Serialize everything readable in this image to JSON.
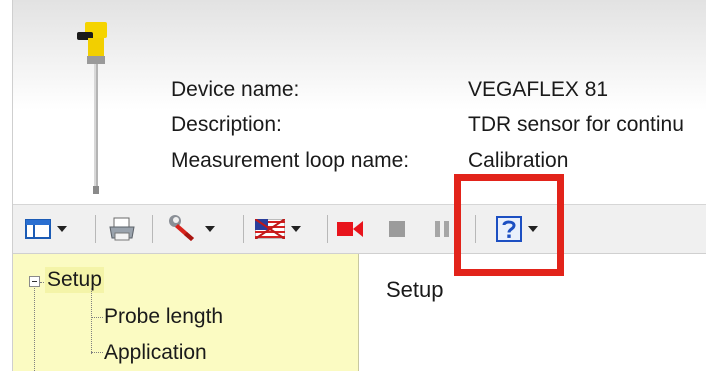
{
  "device_info": {
    "device_name_label": "Device name:",
    "device_name_value": "VEGAFLEX 81",
    "description_label": "Description:",
    "description_value": "TDR sensor for continu",
    "loop_name_label": "Measurement loop name:",
    "loop_name_value": "Calibration"
  },
  "toolbar": {
    "icons": [
      "view-layout-icon",
      "print-icon",
      "wrench-icon",
      "language-flag-icon",
      "record-icon",
      "stop-icon",
      "pause-icon",
      "help-icon"
    ]
  },
  "tree": {
    "root": "Setup",
    "children": [
      "Probe length",
      "Application"
    ]
  },
  "content": {
    "title": "Setup"
  },
  "colors": {
    "highlight": "#e2231a",
    "tree_background": "#fbfbc2",
    "record_red": "#e8141c",
    "help_blue": "#1c4fc2"
  }
}
